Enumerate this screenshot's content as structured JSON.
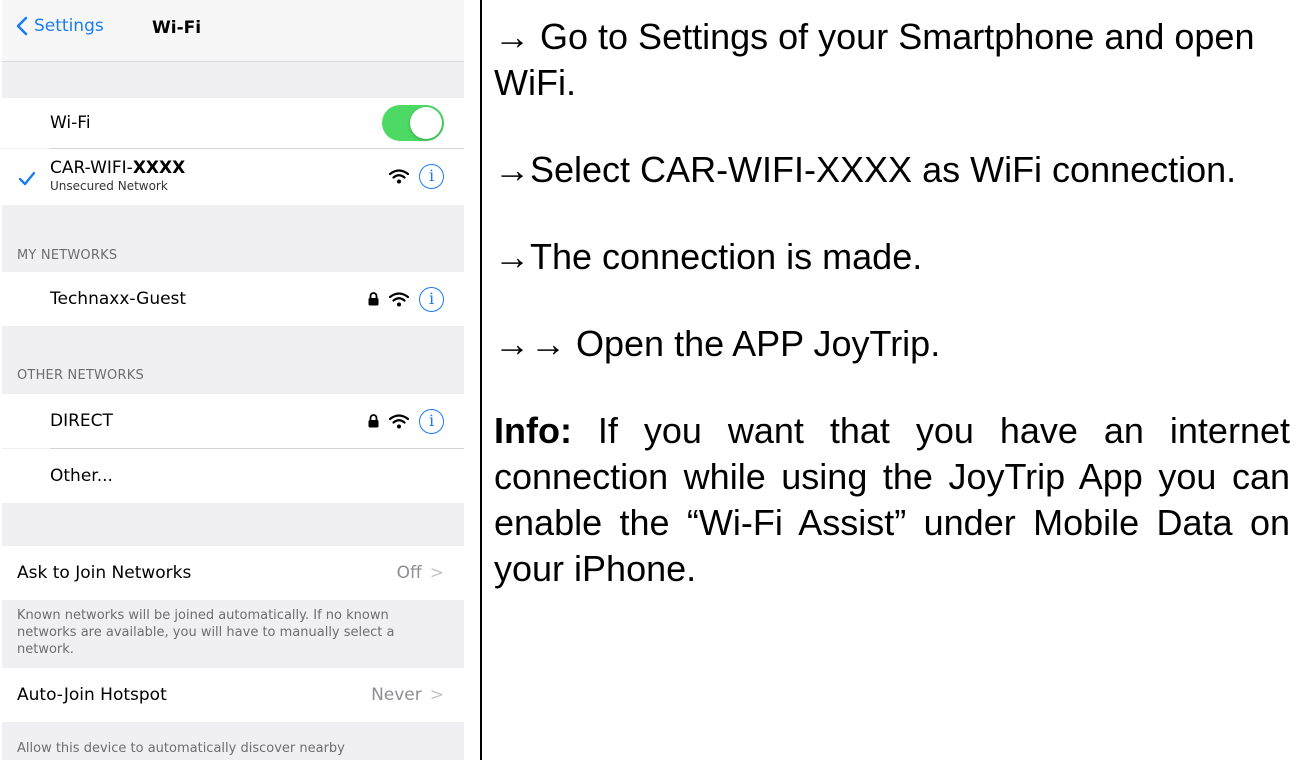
{
  "nav": {
    "back_label": "Settings",
    "title": "Wi-Fi"
  },
  "wifi_toggle": {
    "label": "Wi-Fi",
    "on": true,
    "color": "#4cd964"
  },
  "connected_network": {
    "name_prefix": "CAR-WIFI-",
    "name_bold": "XXXX",
    "subtitle": "Unsecured Network"
  },
  "my_networks": {
    "header": "MY NETWORKS",
    "items": [
      {
        "name": "Technaxx-Guest",
        "locked": true
      }
    ]
  },
  "other_networks": {
    "header": "OTHER NETWORKS",
    "items": [
      {
        "name": "DIRECT",
        "locked": true
      }
    ],
    "other_label": "Other..."
  },
  "ask_to_join": {
    "label": "Ask to Join Networks",
    "value": "Off",
    "footnote": "Known networks will be joined automatically. If no known networks are available, you will have to manually select a network."
  },
  "auto_join": {
    "label": "Auto-Join Hotspot",
    "value": "Never",
    "footnote": "Allow this device to automatically discover nearby"
  },
  "instructions": {
    "step1": "→ Go to Settings of your Smartphone and open WiFi.",
    "step2": "→Select CAR-WIFI-XXXX as WiFi connection.",
    "step3": "→The connection is made.",
    "step4": "→→ Open the APP JoyTrip.",
    "info_label": "Info:",
    "info_text": " If you want that you have an internet connection while using the JoyTrip App you can enable the “Wi-Fi Assist” under Mobile Data on your iPhone."
  },
  "colors": {
    "accent": "#1a7cf5",
    "toggle_on": "#4cd964",
    "group_bg": "#efeff4"
  }
}
